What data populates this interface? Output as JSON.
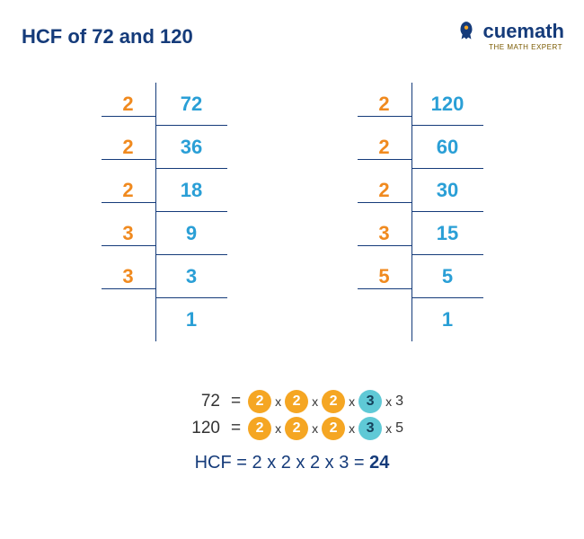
{
  "title": "HCF of 72 and 120",
  "brand": {
    "name": "cuemath",
    "tagline": "THE MATH EXPERT"
  },
  "tables": {
    "left": {
      "number": 72,
      "rows": [
        {
          "d": "2",
          "n": "72"
        },
        {
          "d": "2",
          "n": "36"
        },
        {
          "d": "2",
          "n": "18"
        },
        {
          "d": "3",
          "n": "9"
        },
        {
          "d": "3",
          "n": "3"
        },
        {
          "d": "",
          "n": "1"
        }
      ]
    },
    "right": {
      "number": 120,
      "rows": [
        {
          "d": "2",
          "n": "120"
        },
        {
          "d": "2",
          "n": "60"
        },
        {
          "d": "2",
          "n": "30"
        },
        {
          "d": "3",
          "n": "15"
        },
        {
          "d": "5",
          "n": "5"
        },
        {
          "d": "",
          "n": "1"
        }
      ]
    }
  },
  "factorization": {
    "line1": {
      "num": "72",
      "factors": [
        {
          "v": "2",
          "cls": "common"
        },
        {
          "v": "2",
          "cls": "common"
        },
        {
          "v": "2",
          "cls": "common"
        },
        {
          "v": "3",
          "cls": "common3"
        },
        {
          "v": "3",
          "cls": "plain"
        }
      ]
    },
    "line2": {
      "num": "120",
      "factors": [
        {
          "v": "2",
          "cls": "common"
        },
        {
          "v": "2",
          "cls": "common"
        },
        {
          "v": "2",
          "cls": "common"
        },
        {
          "v": "3",
          "cls": "common3"
        },
        {
          "v": "5",
          "cls": "plain"
        }
      ]
    }
  },
  "hcf": {
    "label": "HCF",
    "expression": "2 x 2 x 2 x 3",
    "result": "24"
  }
}
